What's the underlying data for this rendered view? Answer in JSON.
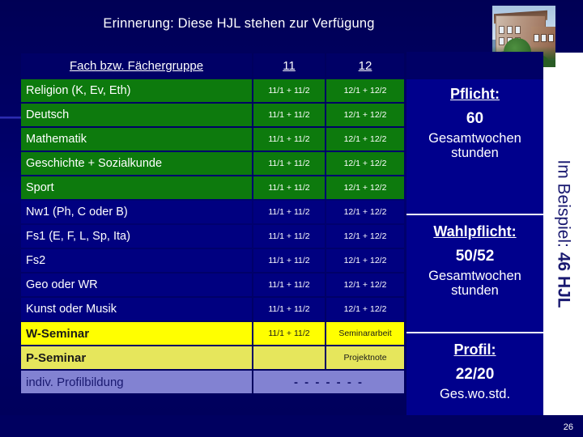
{
  "slide": {
    "title": "Erinnerung: Diese HJL stehen zur Verfügung",
    "number": "26",
    "background_color": "#000060",
    "photo_alt": "school-building-photo"
  },
  "table": {
    "headers": [
      "Fach bzw. Fächergruppe",
      "11",
      "12",
      ""
    ],
    "rows": [
      {
        "name": "Religion (K, Ev, Eth)",
        "c11": "11/1 + 11/2",
        "c12": "12/1 + 12/2",
        "style": "green"
      },
      {
        "name": "Deutsch",
        "c11": "11/1 + 11/2",
        "c12": "12/1 + 12/2",
        "style": "green"
      },
      {
        "name": "Mathematik",
        "c11": "11/1 + 11/2",
        "c12": "12/1 + 12/2",
        "style": "green"
      },
      {
        "name": "Geschichte + Sozialkunde",
        "c11": "11/1 + 11/2",
        "c12": "12/1 + 12/2",
        "style": "green"
      },
      {
        "name": "Sport",
        "c11": "11/1 + 11/2",
        "c12": "12/1 + 12/2",
        "style": "green"
      },
      {
        "name": "Nw1 (Ph, C oder B)",
        "c11": "11/1 + 11/2",
        "c12": "12/1 + 12/2",
        "style": "blue"
      },
      {
        "name": "Fs1 (E, F, L, Sp, Ita)",
        "c11": "11/1 + 11/2",
        "c12": "12/1 + 12/2",
        "style": "blue"
      },
      {
        "name": "Fs2",
        "c11": "11/1 + 11/2",
        "c12": "12/1 + 12/2",
        "style": "blue"
      },
      {
        "name": "Geo oder WR",
        "c11": "11/1 + 11/2",
        "c12": "12/1 + 12/2",
        "style": "blue"
      },
      {
        "name": "Kunst oder Musik",
        "c11": "11/1 + 11/2",
        "c12": "12/1 + 12/2",
        "style": "blue"
      },
      {
        "name": "W-Seminar",
        "c11": "11/1 + 11/2",
        "c12": "Seminararbeit",
        "style": "yellow"
      },
      {
        "name": "P-Seminar",
        "c11": "",
        "c12": "Projektnote",
        "style": "paleyellow"
      },
      {
        "name": "indiv. Profilbildung",
        "c11": "- - - - - - -",
        "c12": "",
        "style": "periwinkle",
        "merged": true
      }
    ],
    "colors": {
      "header": "#000066",
      "green": "#0d7a0d",
      "blue": "#000080",
      "yellow": "#ffff00",
      "paleyellow": "#e6e65c",
      "periwinkle": "#8282d2"
    }
  },
  "panel": {
    "blocks": [
      {
        "heading": "Pflicht:",
        "number": "60",
        "subtitle": "Gesamtwochen\nstunden"
      },
      {
        "heading": "Wahlpflicht:",
        "number": "50/52",
        "subtitle": "Gesamtwochen\nstunden"
      },
      {
        "heading": "Profil:",
        "number": "22/20",
        "subtitle": "Ges.wo.std."
      }
    ]
  },
  "sidebar": {
    "vertical_lead": "Im Beispiel: ",
    "vertical_bold": "46 HJL"
  }
}
